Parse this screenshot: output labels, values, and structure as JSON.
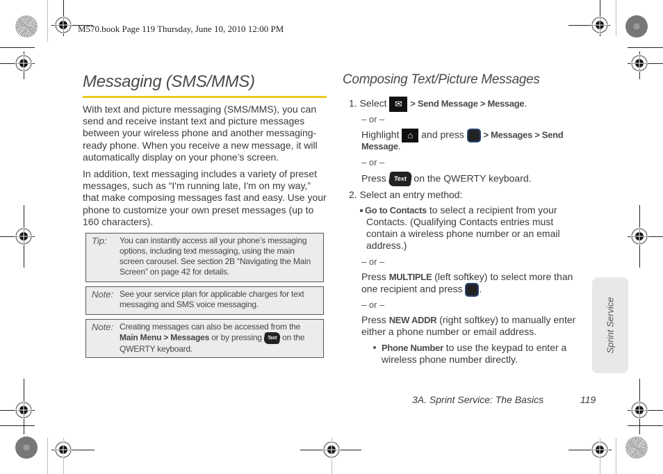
{
  "print_slug": "M570.book  Page 119  Thursday, June 10, 2010  12:00 PM",
  "colors": {
    "accent_rule": "#e9c91e",
    "note_bg": "#ececec",
    "side_tab_bg": "#e8e8e8"
  },
  "left": {
    "title": "Messaging (SMS/MMS)",
    "paragraphs": [
      "With text and picture messaging (SMS/MMS), you can send and receive instant text and picture messages between your wireless phone and another messaging-ready phone. When you receive a new message, it will automatically display on your phone’s screen.",
      "In addition, text messaging includes a variety of preset messages, such as “I'm running late, I'm on my way,” that make composing messages fast and easy. Use your phone to customize your own preset messages (up to 160 characters)."
    ],
    "tip": {
      "label": "Tip:",
      "text": "You can instantly access all your phone’s messaging options, including text messaging, using the main screen carousel. See section 2B “Navigating the Main Screen” on page 42 for details."
    },
    "note1": {
      "label": "Note:",
      "text": "See your service plan for applicable charges for text messaging and SMS voice messaging."
    },
    "note2": {
      "label": "Note:",
      "text_before": "Creating messages can also be accessed from the ",
      "menu1": "Main Menu",
      "sep": " > ",
      "menu2": "Messages",
      "text_mid": " or by pressing ",
      "key_label": "Text",
      "text_after": " on the QWERTY keyboard."
    }
  },
  "right": {
    "title": "Composing Text/Picture Messages",
    "step1": {
      "num": "1.",
      "select": "Select",
      "path1": "> Send Message > Message",
      "period": ".",
      "or1": "– or –",
      "highlight": "Highlight",
      "and_press": "and press",
      "path2a": "> Messages > Send",
      "path2b": "Message",
      "or2": "– or –",
      "press": "Press",
      "text_key": "Text",
      "on_qwerty": "on the QWERTY keyboard."
    },
    "step2": {
      "num": "2.",
      "text": "Select an entry method:",
      "go_contacts_bold": "Go to Contacts",
      "go_contacts_rest1": " to select a recipient from your",
      "go_contacts_lines": [
        "Contacts. (Qualifying Contacts entries must",
        "contain a wireless phone number or an email",
        "address.)"
      ],
      "or3": "– or –",
      "multiple_pre": "Press ",
      "multiple_bold": "MULTIPLE",
      "multiple_rest": " (left softkey) to select more than",
      "multiple_line2": "one recipient and press",
      "or4": "– or –",
      "newaddr_pre": "Press ",
      "newaddr_bold": "NEW ADDR",
      "newaddr_rest": " (right softkey) to manually enter",
      "newaddr_line2": "either a phone number or email address.",
      "phone_bold": "Phone Number",
      "phone_rest": " to use the keypad to enter a",
      "phone_line2": "wireless phone number directly."
    }
  },
  "footer": {
    "section": "3A. Sprint Service: The Basics",
    "page": "119"
  },
  "side_tab": "Sprint Service",
  "icons": {
    "messaging": "messaging-chat-envelope-icon",
    "home": "home-icon",
    "ok_key": "menu-ok-key-icon",
    "text_key": "text-key-icon"
  }
}
